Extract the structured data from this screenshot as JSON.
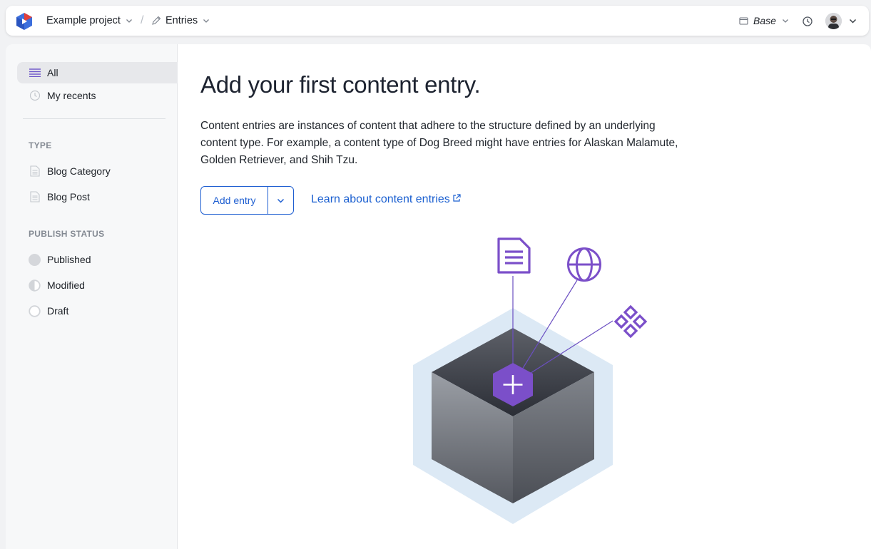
{
  "header": {
    "project_label": "Example project",
    "section_label": "Entries",
    "branch_label": "Base"
  },
  "sidebar": {
    "nav": [
      {
        "label": "All",
        "icon": "list-icon",
        "active": true
      },
      {
        "label": "My recents",
        "icon": "clock-icon",
        "active": false
      }
    ],
    "type_heading": "TYPE",
    "types": [
      {
        "label": "Blog Category",
        "icon": "document-icon"
      },
      {
        "label": "Blog Post",
        "icon": "document-icon"
      }
    ],
    "status_heading": "PUBLISH STATUS",
    "statuses": [
      {
        "label": "Published",
        "icon": "filled-circle-icon"
      },
      {
        "label": "Modified",
        "icon": "half-circle-icon"
      },
      {
        "label": "Draft",
        "icon": "empty-circle-icon"
      }
    ]
  },
  "main": {
    "title": "Add your first content entry.",
    "description": "Content entries are instances of content that adhere to the structure defined by an underlying content type. For example, a content type of Dog Breed might have entries for Alaskan Malamute, Golden Retriever, and Shih Tzu.",
    "add_entry_label": "Add entry",
    "learn_link_label": "Learn about content entries"
  },
  "colors": {
    "accent": "#1f5fd1",
    "purple": "#7b4fc9",
    "sidebar_bg": "#f7f8f9"
  }
}
